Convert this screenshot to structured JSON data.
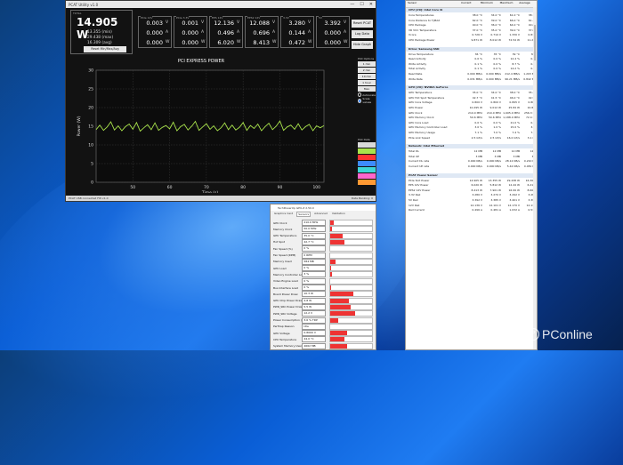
{
  "power_logger": {
    "title": "PCAT Utility v1.0",
    "window_controls": [
      "—",
      "☐",
      "✕"
    ],
    "total": {
      "label": "TOTAL",
      "value": "14.905 W",
      "min": "13.355 (min)",
      "max": "29.438 (max)",
      "avg": "16.309 (avg)",
      "button": "Reset Min/Max/Avg"
    },
    "rails": [
      {
        "label": "PCIe 12V",
        "v": "0.003",
        "a": "0.000",
        "w": "0.000"
      },
      {
        "label": "PCIe 3.3V",
        "v": "0.001",
        "a": "0.000",
        "w": "0.000"
      },
      {
        "label": "EPS 12V",
        "v": "12.136",
        "a": "0.496",
        "w": "6.020"
      },
      {
        "label": "EPS2 12V",
        "v": "12.088",
        "a": "0.696",
        "w": "8.413"
      },
      {
        "label": "3.3V",
        "v": "3.280",
        "a": "0.144",
        "w": "0.472"
      },
      {
        "label": "5V",
        "v": "3.392",
        "a": "0.000",
        "w": "0.000"
      }
    ],
    "units": [
      "V",
      "A",
      "W"
    ],
    "side_buttons": [
      "Reset PCAT",
      "Log Data",
      "Hide Graph"
    ],
    "chart_title": "PCI EXPRESS POWER",
    "panel": {
      "plot_options": "Plot Options",
      "time_buttons": [
        "1 min",
        "2 min",
        "10 min",
        "1 hour",
        "Max"
      ],
      "radio": [
        "Autoscale",
        "Scale values"
      ],
      "plot_data": "Plot Data",
      "series_colors": [
        "#d9d9d9",
        "#a9e34b",
        "#ff3333",
        "#3d8bfd",
        "#3dd6d6",
        "#ff66cc",
        "#ff9933"
      ]
    },
    "status_left": "PCAT USB connected  FW v1.0",
    "status_right": "Data Banking: 0"
  },
  "chart_data": {
    "type": "line",
    "title": "PCI EXPRESS POWER",
    "xlabel": "Time (s)",
    "ylabel": "Power (W)",
    "xlim": [
      0,
      100
    ],
    "ylim": [
      0,
      30
    ],
    "x_ticks": [
      50,
      60,
      70,
      80,
      90,
      100
    ],
    "y_ticks": [
      0,
      5,
      10,
      15,
      20,
      25,
      30
    ],
    "grid": true,
    "series": [
      {
        "color": "#a9e34b",
        "x": [
          40,
          41,
          42,
          43,
          44,
          45,
          46,
          47,
          48,
          49,
          50,
          51,
          52,
          53,
          54,
          55,
          56,
          57,
          58,
          59,
          60,
          61,
          62,
          63,
          64,
          65,
          66,
          67,
          68,
          69,
          70,
          71,
          72,
          73,
          74,
          75,
          76,
          77,
          78,
          79,
          80,
          81,
          82,
          83,
          84,
          85,
          86,
          87,
          88,
          89,
          90,
          91,
          92,
          93,
          94,
          95,
          96,
          97,
          98,
          99,
          100,
          101,
          102
        ],
        "values": [
          14.1,
          15.3,
          13.9,
          14.8,
          16.2,
          14.0,
          15.1,
          13.8,
          14.9,
          15.6,
          14.2,
          16.0,
          13.7,
          14.6,
          15.4,
          14.1,
          15.9,
          13.9,
          14.7,
          15.2,
          14.3,
          16.1,
          13.8,
          14.9,
          15.5,
          14.0,
          15.0,
          16.3,
          13.9,
          14.8,
          15.7,
          14.2,
          15.1,
          13.8,
          14.6,
          15.9,
          14.1,
          15.3,
          14.0,
          14.7,
          16.0,
          13.9,
          15.2,
          14.4,
          15.6,
          13.8,
          14.9,
          15.8,
          14.1,
          15.0,
          16.4,
          13.9,
          14.8,
          15.3,
          14.2,
          15.7,
          14.0,
          14.9,
          15.5,
          13.8,
          15.1,
          14.6,
          15.2
        ]
      }
    ]
  },
  "gpuz": {
    "title": "TechPowerUp GPU-Z 2.50.0",
    "tabs": [
      "Graphics Card",
      "Sensors",
      "Advanced",
      "Validation"
    ],
    "rows": [
      {
        "k": "GPU Clock",
        "v": "210.0 MHz",
        "g": 0.08
      },
      {
        "k": "Memory Clock",
        "v": "50.0 MHz",
        "g": 0.05
      },
      {
        "k": "GPU Temperature",
        "v": "35.0 °C",
        "g": 0.3
      },
      {
        "k": "Hot Spot",
        "v": "42.7 °C",
        "g": 0.35
      },
      {
        "k": "Fan Speed (%)",
        "v": "0 %",
        "g": 0.0
      },
      {
        "k": "Fan Speed (RPM)",
        "v": "0 RPM",
        "g": 0.0
      },
      {
        "k": "Memory Used",
        "v": "584 MB",
        "g": 0.12
      },
      {
        "k": "GPU Load",
        "v": "0 %",
        "g": 0.02
      },
      {
        "k": "Memory Controller Load",
        "v": "3 %",
        "g": 0.04
      },
      {
        "k": "Video Engine Load",
        "v": "0 %",
        "g": 0.0
      },
      {
        "k": "Bus Interface Load",
        "v": "0 %",
        "g": 0.02
      },
      {
        "k": "Board Power Draw",
        "v": "10.3 W",
        "g": 0.55
      },
      {
        "k": "GPU Chip Power Draw",
        "v": "4.8 W",
        "g": 0.45
      },
      {
        "k": "PWR_SRC Power Draw",
        "v": "5.5 W",
        "g": 0.5
      },
      {
        "k": "PWR_SRC Voltage",
        "v": "12.2 V",
        "g": 0.6
      },
      {
        "k": "Power Consumption (%)",
        "v": "3.6 % TDP",
        "g": 0.2
      },
      {
        "k": "PerfCap Reason",
        "v": "Idle",
        "g": 0.0
      },
      {
        "k": "GPU Voltage",
        "v": "0.8000 V",
        "g": 0.4
      },
      {
        "k": "CPU Temperature",
        "v": "44.0 °C",
        "g": 0.35
      },
      {
        "k": "System Memory Used",
        "v": "4662 MB",
        "g": 0.4
      }
    ]
  },
  "hwinfo": {
    "columns": [
      "Sensor",
      "Current",
      "Minimum",
      "Maximum",
      "Average"
    ],
    "sections": [
      {
        "name": "CPU [#0]: Intel Core i9",
        "rows": [
          [
            "Core Temperatures",
            "38.0 °C",
            "34.0 °C",
            "61.0 °C",
            "38.7 °C"
          ],
          [
            "Core Distance to TjMAX",
            "62.0 °C",
            "39.0 °C",
            "66.0 °C",
            "61.3 °C"
          ],
          [
            "CPU Package",
            "40.0 °C",
            "36.0 °C",
            "64.0 °C",
            "40.6 °C"
          ],
          [
            "VR VCC Temperature",
            "37.0 °C",
            "35.0 °C",
            "39.0 °C",
            "37.0 °C"
          ],
          [
            "Vcore",
            "0.726 V",
            "0.710 V",
            "1.330 V",
            "0.812 V"
          ],
          [
            "CPU Package Power",
            "9.871 W",
            "8.012 W",
            "72.54 W",
            "11.23 W"
          ]
        ]
      },
      {
        "name": "Drive: Samsung SSD",
        "rows": [
          [
            "Drive Temperature",
            "36 °C",
            "35 °C",
            "39 °C",
            "36 °C"
          ],
          [
            "Read Activity",
            "0.0 %",
            "0.0 %",
            "12.4 %",
            "0.3 %"
          ],
          [
            "Write Activity",
            "0.1 %",
            "0.0 %",
            "8.7 %",
            "0.2 %"
          ],
          [
            "Total Activity",
            "0.1 %",
            "0.0 %",
            "14.2 %",
            "0.4 %"
          ],
          [
            "Read Rate",
            "0.000 MB/s",
            "0.000 MB/s",
            "212.4 MB/s",
            "1.203 MB/s"
          ],
          [
            "Write Rate",
            "0.031 MB/s",
            "0.000 MB/s",
            "96.21 MB/s",
            "0.842 MB/s"
          ]
        ]
      },
      {
        "name": "GPU [#0]: NVIDIA GeForce",
        "rows": [
          [
            "GPU Temperature",
            "35.0 °C",
            "34.0 °C",
            "38.0 °C",
            "35.2 °C"
          ],
          [
            "GPU Hot Spot Temperature",
            "42.7 °C",
            "41.5 °C",
            "46.0 °C",
            "42.9 °C"
          ],
          [
            "GPU Core Voltage",
            "0.800 V",
            "0.800 V",
            "0.895 V",
            "0.803 V"
          ],
          [
            "GPU Power",
            "10.295 W",
            "9.012 W",
            "25.84 W",
            "10.88 W"
          ],
          [
            "GPU Clock",
            "210.0 MHz",
            "210.0 MHz",
            "1,905.0 MHz",
            "256.3 MHz"
          ],
          [
            "GPU Memory Clock",
            "50.6 MHz",
            "50.6 MHz",
            "1,188.0 MHz",
            "72.4 MHz"
          ],
          [
            "GPU Core Load",
            "0.0 %",
            "0.0 %",
            "21.0 %",
            "0.6 %"
          ],
          [
            "GPU Memory Controller Load",
            "3.0 %",
            "1.0 %",
            "15.0 %",
            "3.2 %"
          ],
          [
            "GPU Memory Usage",
            "7.1 %",
            "7.0 %",
            "7.4 %",
            "7.1 %"
          ],
          [
            "PCIe Link Speed",
            "2.5 GT/s",
            "2.5 GT/s",
            "16.0 GT/s",
            "3.1 GT/s"
          ]
        ]
      },
      {
        "name": "Network: Intel Ethernet",
        "rows": [
          [
            "Total DL",
            "12 MB",
            "12 MB",
            "12 MB",
            "12 MB"
          ],
          [
            "Total UP",
            "3 MB",
            "3 MB",
            "3 MB",
            "3 MB"
          ],
          [
            "Current DL rate",
            "0.000 KB/s",
            "0.000 KB/s",
            "28.12 KB/s",
            "0.210 KB/s"
          ],
          [
            "Current UP rate",
            "0.000 KB/s",
            "0.000 KB/s",
            "5.42 KB/s",
            "0.081 KB/s"
          ]
        ]
      },
      {
        "name": "PCAT Power Sensor",
        "rows": [
          [
            "PCIe Slot Power",
            "14.905 W",
            "13.355 W",
            "29.438 W",
            "16.309 W"
          ],
          [
            "EPS 12V Power",
            "6.020 W",
            "5.812 W",
            "12.44 W",
            "6.210 W"
          ],
          [
            "EPS2 12V Power",
            "8.413 W",
            "7.901 W",
            "16.99 W",
            "8.605 W"
          ],
          [
            "3.3V Rail",
            "3.280 V",
            "3.270 V",
            "3.292 V",
            "3.281 V"
          ],
          [
            "5V Rail",
            "3.392 V",
            "3.385 V",
            "3.401 V",
            "3.392 V"
          ],
          [
            "12V Rail",
            "12.136 V",
            "12.101 V",
            "12.170 V",
            "12.138 V"
          ],
          [
            "Rail Current",
            "0.496 A",
            "0.481 A",
            "1.032 A",
            "0.512 A"
          ]
        ]
      }
    ]
  },
  "watermark": "PConline"
}
